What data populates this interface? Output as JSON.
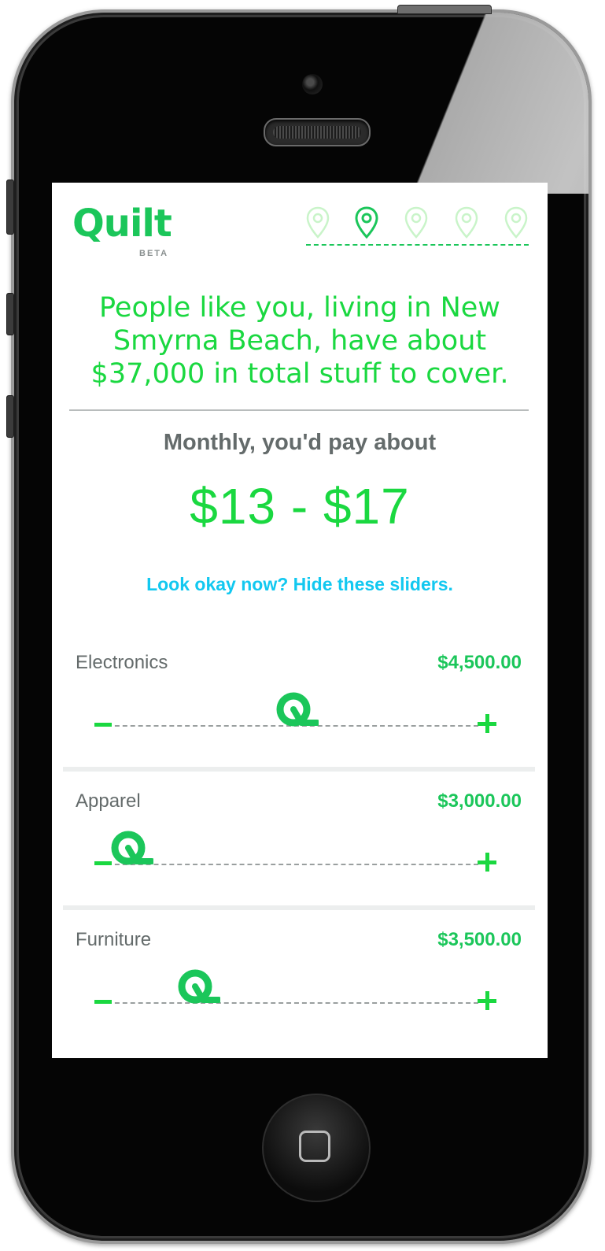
{
  "app": {
    "logo": "Quilt",
    "badge": "BETA"
  },
  "progress": {
    "step_count": 5,
    "current_step": 2
  },
  "headline": "People like you, living in New Smyrna Beach, have about $37,000 in total stuff to cover.",
  "estimate": {
    "label": "Monthly, you'd pay about",
    "range": "$13 - $17"
  },
  "hide_sliders_link": "Look okay now? Hide these sliders.",
  "sliders": [
    {
      "name": "Electronics",
      "amount": "$4,500.00",
      "level": 0.45
    },
    {
      "name": "Apparel",
      "amount": "$3,000.00",
      "level": 0.03
    },
    {
      "name": "Furniture",
      "amount": "$3,500.00",
      "level": 0.2
    }
  ],
  "colors": {
    "brand_green": "#1bc65a",
    "accent_green": "#1ad840",
    "link_cyan": "#12c8f0",
    "text_gray": "#646b6b"
  }
}
